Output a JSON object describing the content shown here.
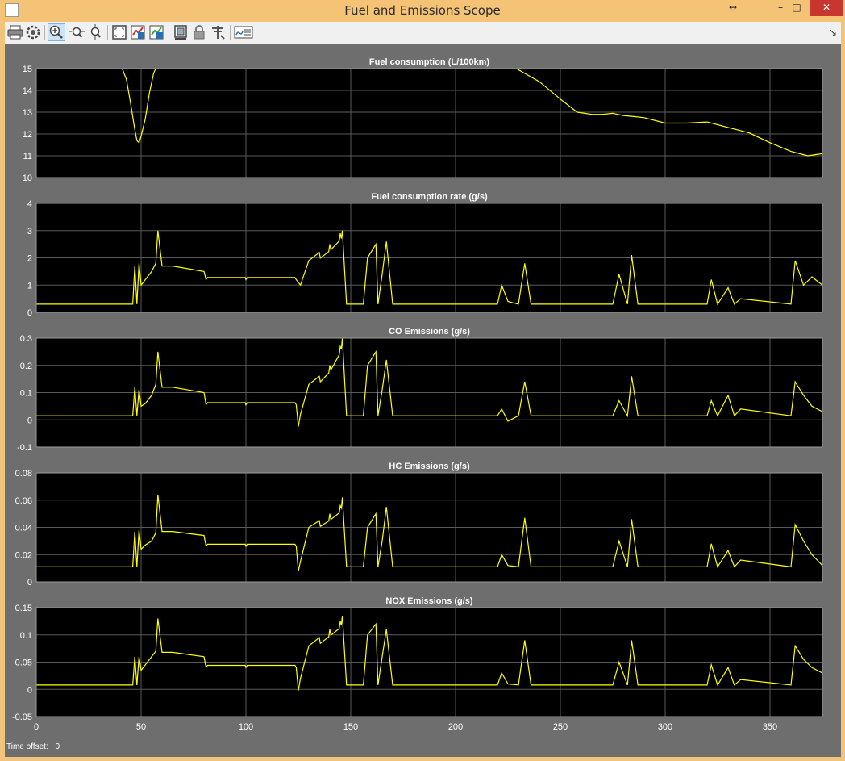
{
  "window": {
    "title": "Fuel and Emissions Scope",
    "buttons": [
      "↔",
      "–",
      "□",
      "✕"
    ],
    "close_color": "#c7372f"
  },
  "toolbar": {
    "icons": [
      "print-icon",
      "settings-icon",
      "zoom-in-icon",
      "zoom-x-icon",
      "zoom-y-icon",
      "autoscale-icon",
      "save-axes-icon",
      "restore-axes-icon",
      "floating-scope-icon",
      "lock-axes-icon",
      "signal-selection-icon",
      "legend-icon"
    ],
    "corner_glyph": "↘"
  },
  "status": {
    "label": "Time offset:",
    "value": "0"
  },
  "colors": {
    "background": "#000000",
    "trace": "#ffff00",
    "grid": "#5a5a5a",
    "frame": "#6e6e6e"
  },
  "chart_data": [
    {
      "type": "line",
      "title": "Fuel consumption (L/100km)",
      "xlim": [
        0,
        375
      ],
      "ylim": [
        10,
        15
      ],
      "yticks": [
        "15",
        "14",
        "13",
        "12",
        "11",
        "10"
      ],
      "xticks": [],
      "x": [
        0,
        41,
        43,
        45,
        47,
        48,
        49,
        50,
        52,
        54,
        56,
        57,
        58,
        60,
        80,
        100,
        150,
        200,
        229,
        240,
        250,
        258,
        265,
        270,
        275,
        280,
        285,
        290,
        300,
        310,
        320,
        330,
        340,
        350,
        360,
        368,
        375
      ],
      "y": [
        15,
        15,
        14.5,
        13.4,
        12.2,
        11.7,
        11.6,
        11.9,
        12.7,
        13.9,
        14.8,
        15,
        15,
        15,
        15,
        15,
        15,
        15,
        15,
        14.4,
        13.6,
        13.0,
        12.9,
        12.9,
        12.95,
        12.85,
        12.8,
        12.75,
        12.5,
        12.5,
        12.55,
        12.3,
        12.05,
        11.6,
        11.2,
        11.0,
        11.1
      ],
      "grid": true
    },
    {
      "type": "line",
      "title": "Fuel consumption rate (g/s)",
      "xlim": [
        0,
        375
      ],
      "ylim": [
        0,
        4
      ],
      "yticks": [
        "4",
        "3",
        "2",
        "1",
        "0"
      ],
      "xticks": [],
      "baseline": 0.3,
      "plateau": 1.2,
      "x": [
        0,
        46,
        47,
        48,
        49,
        50,
        52,
        55,
        57,
        58,
        60,
        65,
        80,
        81,
        100,
        124,
        126,
        130,
        135,
        140,
        145,
        146,
        148,
        156,
        158,
        162,
        163,
        165,
        167,
        170,
        220,
        222,
        225,
        230,
        233,
        236,
        240,
        275,
        278,
        282,
        284,
        287,
        320,
        322,
        325,
        330,
        333,
        336,
        360,
        362,
        366,
        370,
        375
      ],
      "y": [
        0.3,
        0.3,
        1.7,
        0.3,
        1.8,
        1.0,
        1.2,
        1.5,
        1.8,
        3.0,
        1.7,
        1.7,
        1.5,
        1.2,
        1.2,
        1.2,
        1.0,
        1.9,
        2.2,
        2.5,
        2.9,
        3.0,
        0.3,
        0.3,
        2.0,
        2.5,
        0.3,
        1.4,
        2.6,
        0.3,
        0.3,
        1.0,
        0.4,
        0.3,
        1.8,
        0.3,
        0.3,
        0.3,
        1.4,
        0.3,
        2.1,
        0.3,
        0.3,
        1.2,
        0.3,
        0.9,
        0.3,
        0.5,
        0.3,
        1.9,
        1.0,
        1.3,
        1.0
      ],
      "grid": true
    },
    {
      "type": "line",
      "title": "CO Emissions (g/s)",
      "xlim": [
        0,
        375
      ],
      "ylim": [
        -0.1,
        0.3
      ],
      "yticks": [
        "0.3",
        "0.2",
        "0.1",
        "0",
        "-0.1"
      ],
      "xticks": [],
      "baseline": 0.015,
      "plateau": 0.055,
      "x": [
        0,
        46,
        47,
        48,
        49,
        50,
        52,
        55,
        57,
        58,
        60,
        65,
        80,
        81,
        100,
        124,
        125,
        126,
        130,
        135,
        140,
        145,
        146,
        148,
        156,
        158,
        162,
        163,
        165,
        167,
        170,
        220,
        222,
        225,
        230,
        233,
        236,
        240,
        275,
        278,
        282,
        284,
        287,
        320,
        322,
        325,
        330,
        333,
        336,
        360,
        362,
        366,
        370,
        375
      ],
      "y": [
        0.015,
        0.015,
        0.12,
        0.015,
        0.11,
        0.05,
        0.06,
        0.09,
        0.13,
        0.25,
        0.12,
        0.12,
        0.1,
        0.055,
        0.055,
        0.055,
        -0.025,
        0.02,
        0.13,
        0.16,
        0.2,
        0.27,
        0.3,
        0.015,
        0.015,
        0.2,
        0.25,
        0.015,
        0.11,
        0.22,
        0.015,
        0.015,
        0.04,
        -0.005,
        0.015,
        0.14,
        0.015,
        0.015,
        0.015,
        0.07,
        0.015,
        0.16,
        0.015,
        0.015,
        0.07,
        0.015,
        0.09,
        0.015,
        0.04,
        0.015,
        0.14,
        0.09,
        0.05,
        0.03
      ],
      "grid": true
    },
    {
      "type": "line",
      "title": "HC Emissions (g/s)",
      "xlim": [
        0,
        375
      ],
      "ylim": [
        0,
        0.08
      ],
      "yticks": [
        "0.08",
        "0.06",
        "0.04",
        "0.02",
        "0"
      ],
      "xticks": [],
      "baseline": 0.011,
      "plateau": 0.026,
      "x": [
        0,
        46,
        47,
        48,
        49,
        50,
        52,
        55,
        57,
        58,
        60,
        65,
        80,
        81,
        100,
        124,
        125,
        126,
        130,
        135,
        140,
        145,
        146,
        148,
        156,
        158,
        162,
        163,
        165,
        167,
        170,
        220,
        222,
        225,
        230,
        233,
        236,
        240,
        275,
        278,
        282,
        284,
        287,
        320,
        322,
        325,
        330,
        333,
        336,
        360,
        362,
        366,
        370,
        375
      ],
      "y": [
        0.011,
        0.011,
        0.037,
        0.011,
        0.038,
        0.024,
        0.027,
        0.03,
        0.036,
        0.064,
        0.037,
        0.037,
        0.034,
        0.026,
        0.026,
        0.026,
        0.008,
        0.015,
        0.04,
        0.045,
        0.05,
        0.056,
        0.062,
        0.011,
        0.011,
        0.04,
        0.05,
        0.011,
        0.03,
        0.055,
        0.011,
        0.011,
        0.02,
        0.012,
        0.011,
        0.047,
        0.011,
        0.011,
        0.011,
        0.03,
        0.011,
        0.046,
        0.011,
        0.011,
        0.028,
        0.011,
        0.023,
        0.011,
        0.016,
        0.011,
        0.042,
        0.03,
        0.02,
        0.012
      ],
      "grid": true
    },
    {
      "type": "line",
      "title": "NOX Emissions (g/s)",
      "xlim": [
        0,
        375
      ],
      "ylim": [
        -0.05,
        0.15
      ],
      "yticks": [
        "0.15",
        "0.1",
        "0.05",
        "0",
        "-0.05"
      ],
      "xticks": [
        "0",
        "50",
        "100",
        "150",
        "200",
        "250",
        "300",
        "350"
      ],
      "xtick_values": [
        0,
        50,
        100,
        150,
        200,
        250,
        300,
        350
      ],
      "baseline": 0.008,
      "plateau": 0.04,
      "x": [
        0,
        46,
        47,
        48,
        49,
        50,
        52,
        55,
        57,
        58,
        60,
        65,
        80,
        81,
        100,
        124,
        125,
        126,
        130,
        135,
        140,
        145,
        146,
        148,
        156,
        158,
        162,
        163,
        165,
        167,
        170,
        220,
        222,
        225,
        230,
        233,
        236,
        240,
        275,
        278,
        282,
        284,
        287,
        320,
        322,
        325,
        330,
        333,
        336,
        360,
        362,
        366,
        370,
        375
      ],
      "y": [
        0.008,
        0.008,
        0.06,
        0.008,
        0.06,
        0.035,
        0.045,
        0.06,
        0.07,
        0.13,
        0.068,
        0.068,
        0.06,
        0.04,
        0.04,
        0.04,
        -0.002,
        0.02,
        0.08,
        0.095,
        0.11,
        0.125,
        0.135,
        0.008,
        0.008,
        0.1,
        0.12,
        0.008,
        0.06,
        0.11,
        0.008,
        0.008,
        0.03,
        0.01,
        0.008,
        0.09,
        0.008,
        0.008,
        0.008,
        0.05,
        0.008,
        0.09,
        0.008,
        0.008,
        0.045,
        0.008,
        0.04,
        0.008,
        0.018,
        0.008,
        0.08,
        0.055,
        0.04,
        0.03
      ],
      "grid": true
    }
  ]
}
